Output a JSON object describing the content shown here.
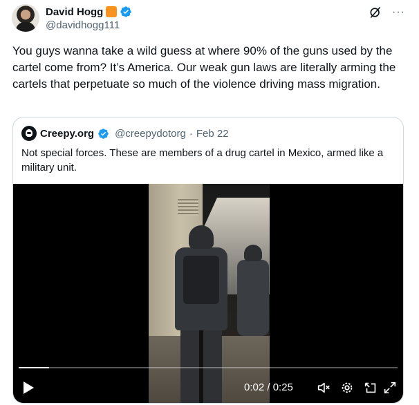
{
  "author": {
    "display_name": "David Hogg",
    "handle": "@davidhogg111"
  },
  "tweet": {
    "text": "You guys wanna take a wild guess at where 90% of the guns used by the cartel come from? It’s America. Our weak gun laws are literally arming the cartels that perpetuate so much of the violence driving mass migration."
  },
  "quoted": {
    "display_name": "Creepy.org",
    "handle": "@creepydotorg",
    "separator": "·",
    "date": "Feb 22",
    "text": "Not special forces. These are members of a drug cartel in Mexico, armed like a military unit."
  },
  "video": {
    "time_display": "0:02 / 0:25",
    "progress_fraction": 0.08
  },
  "icons": {
    "more": "···",
    "verified_color": "#1d9bf0",
    "badge_color": "#f7931e"
  }
}
